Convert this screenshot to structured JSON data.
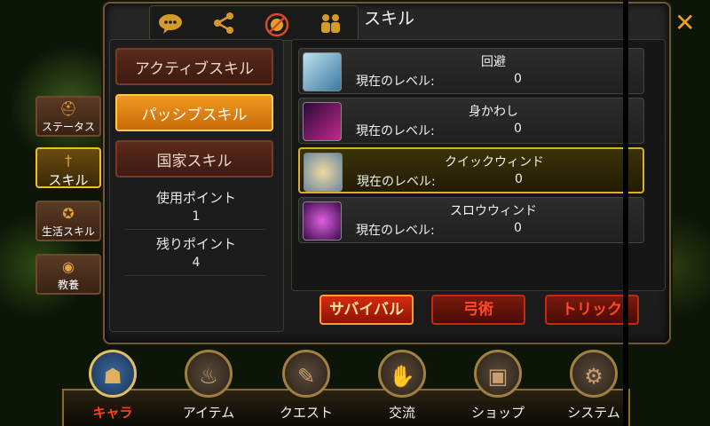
{
  "header": {
    "title": "スキル",
    "tab_icons": [
      "chat-icon",
      "share-icon",
      "compass-icon",
      "party-icon"
    ]
  },
  "side_tabs": [
    {
      "label": "ステータス",
      "icon": "helmet-icon"
    },
    {
      "label": "スキル",
      "icon": "sword-icon",
      "active": true
    },
    {
      "label": "生活スキル",
      "icon": "emblem-icon"
    },
    {
      "label": "教養",
      "icon": "medal-icon"
    }
  ],
  "categories": [
    {
      "label": "アクティブスキル"
    },
    {
      "label": "パッシブスキル",
      "active": true
    },
    {
      "label": "国家スキル"
    }
  ],
  "points": {
    "used_label": "使用ポイント",
    "used_value": "1",
    "remaining_label": "残りポイント",
    "remaining_value": "4"
  },
  "skills": [
    {
      "name": "回避",
      "level_label": "現在のレベル:",
      "level": "0",
      "icon": "evade-icon"
    },
    {
      "name": "身かわし",
      "level_label": "現在のレベル:",
      "level": "0",
      "icon": "dodge-icon"
    },
    {
      "name": "クイックウィンド",
      "level_label": "現在のレベル:",
      "level": "0",
      "icon": "quick-wind-icon",
      "selected": true
    },
    {
      "name": "スロウウィンド",
      "level_label": "現在のレベル:",
      "level": "0",
      "icon": "slow-wind-icon"
    }
  ],
  "sub_tabs": [
    {
      "label": "サバイバル",
      "active": true
    },
    {
      "label": "弓術"
    },
    {
      "label": "トリック"
    }
  ],
  "bottom_nav": [
    {
      "label": "キャラ",
      "icon": "character-icon",
      "active": true
    },
    {
      "label": "アイテム",
      "icon": "bag-icon"
    },
    {
      "label": "クエスト",
      "icon": "scroll-icon"
    },
    {
      "label": "交流",
      "icon": "handshake-icon"
    },
    {
      "label": "ショップ",
      "icon": "chest-icon"
    },
    {
      "label": "システム",
      "icon": "gear-icon"
    }
  ],
  "colors": {
    "accent": "#f09a20",
    "selected_border": "#d8b020",
    "active_nav_text": "#ff4020"
  }
}
